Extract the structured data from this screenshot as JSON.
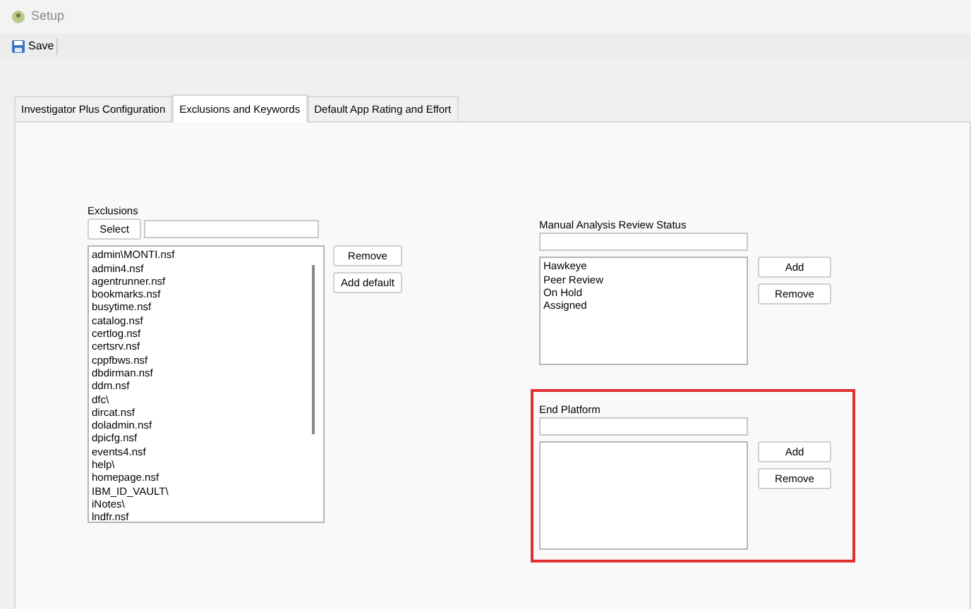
{
  "window": {
    "title": "Setup"
  },
  "toolbar": {
    "buttons": [
      "Save"
    ]
  },
  "tabs": [
    {
      "label": "Investigator Plus Configuration",
      "selected": false
    },
    {
      "label": "Exclusions and Keywords",
      "selected": true
    },
    {
      "label": "Default App Rating and Effort",
      "selected": false
    }
  ],
  "exclusions": {
    "label": "Exclusions",
    "select_button": "Select",
    "items": [
      "admin\\MONTI.nsf",
      "admin4.nsf",
      "agentrunner.nsf",
      "bookmarks.nsf",
      "busytime.nsf",
      "catalog.nsf",
      "certlog.nsf",
      "certsrv.nsf",
      "cppfbws.nsf",
      "dbdirman.nsf",
      "ddm.nsf",
      "dfc\\",
      "dircat.nsf",
      "doladmin.nsf",
      "dpicfg.nsf",
      "events4.nsf",
      "help\\",
      "homepage.nsf",
      "IBM_ID_VAULT\\",
      "iNotes\\",
      "lndfr.nsf"
    ],
    "buttons": [
      "Remove",
      "Add default"
    ]
  },
  "review_status": {
    "label": "Manual Analysis Review Status",
    "items": [
      "Hawkeye",
      "Peer Review",
      "On Hold",
      "Assigned"
    ],
    "buttons": [
      "Add",
      "Remove"
    ],
    "highlighted": false
  },
  "end_platform": {
    "label": "End Platform",
    "buttons": [
      "Add",
      "Remove"
    ],
    "highlighted": true
  }
}
